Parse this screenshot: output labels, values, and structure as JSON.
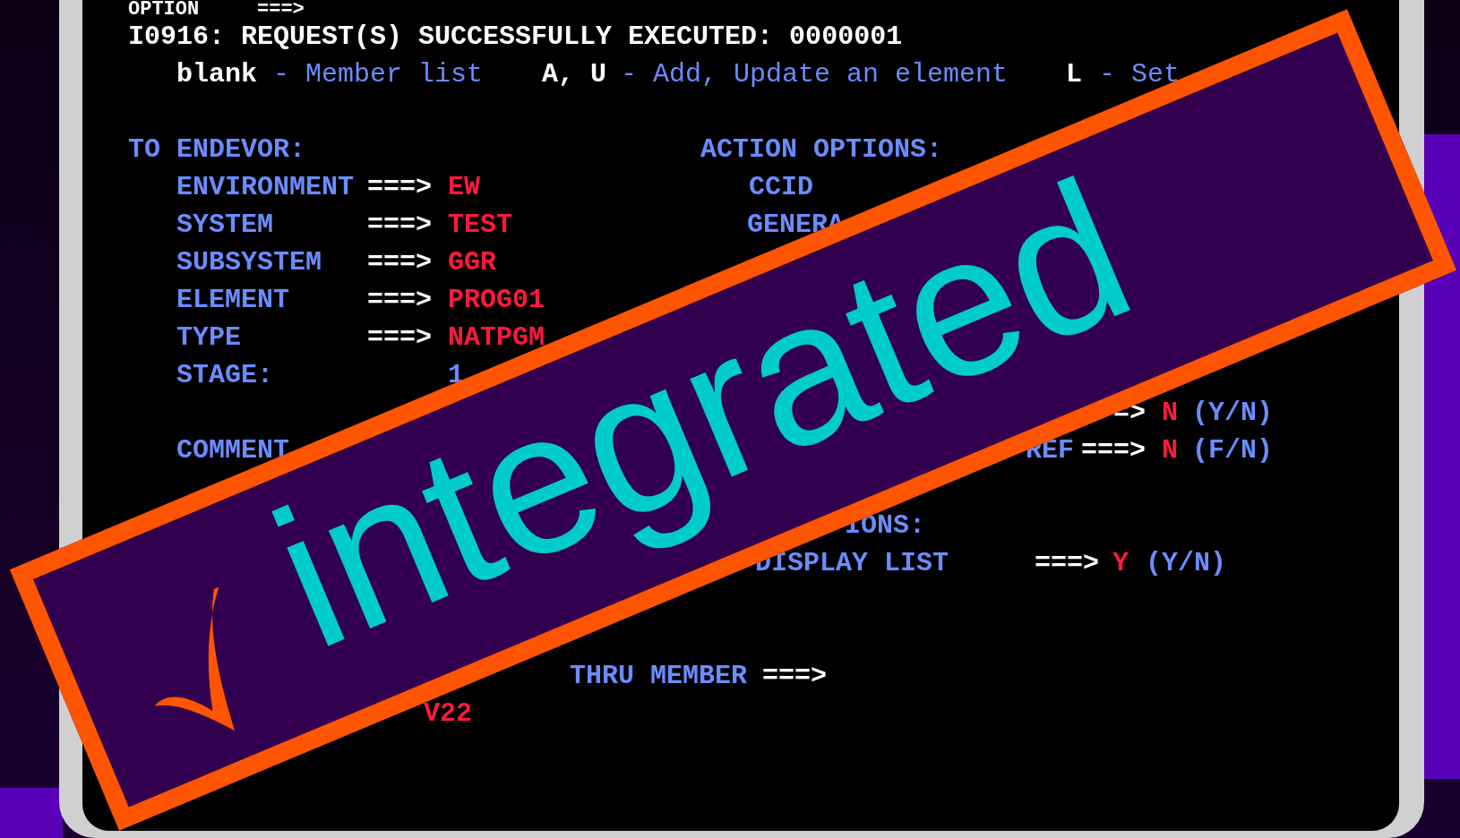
{
  "option_line": {
    "label": "OPTION",
    "prompt": "===>"
  },
  "message": "I0916: REQUEST(S) SUCCESSFULLY EXECUTED: 0000001",
  "legend": [
    {
      "key": "blank",
      "description": "- Member list"
    },
    {
      "key": "A, U",
      "description": "- Add, Update an element"
    },
    {
      "key": "L",
      "description": "- Set"
    }
  ],
  "to_endevor": {
    "heading": "TO ENDEVOR:",
    "fields": [
      {
        "label": "ENVIRONMENT",
        "prompt": "===>",
        "value": "EW"
      },
      {
        "label": "SYSTEM",
        "prompt": "===>",
        "value": "TEST"
      },
      {
        "label": "SUBSYSTEM",
        "prompt": "===>",
        "value": "GGR"
      },
      {
        "label": "ELEMENT",
        "prompt": "===>",
        "value": "PROG01"
      },
      {
        "label": "TYPE",
        "prompt": "===>",
        "value": "NATPGM"
      }
    ],
    "stage": {
      "label": "STAGE:",
      "value": "1"
    },
    "comment": {
      "label": "COMMENT"
    }
  },
  "action_options": {
    "heading": "ACTION OPTIONS:",
    "items": [
      "CCID",
      "GENERA"
    ]
  },
  "option_rows": [
    {
      "label": "",
      "prompt": "=>",
      "value": "N",
      "choices": "(Y/N)"
    },
    {
      "label": "REF",
      "prompt": "===>",
      "value": "N",
      "choices": "(F/N)"
    }
  ],
  "list_options": {
    "heading": "IONS:",
    "field": {
      "label": "DISPLAY LIST",
      "prompt": "===>",
      "value": "Y",
      "choices": "(Y/N)"
    }
  },
  "thru_member": {
    "label": "THRU MEMBER",
    "prompt": "===>"
  },
  "dataset_value": "V22",
  "stamp": {
    "text": "integrated"
  }
}
